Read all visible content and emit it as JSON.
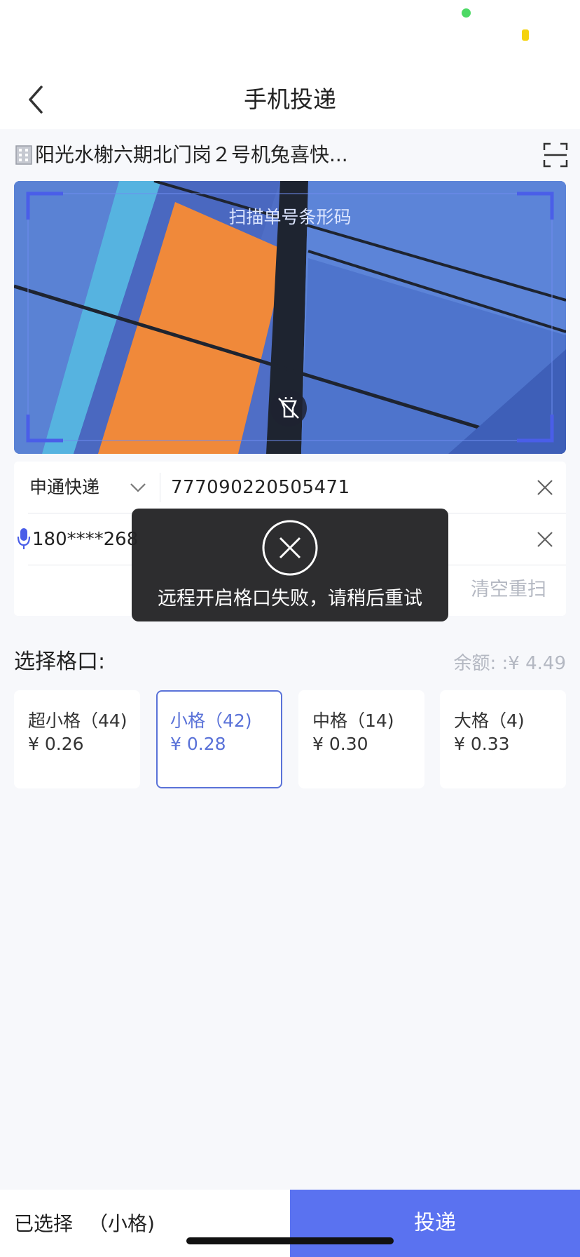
{
  "header": {
    "title": "手机投递"
  },
  "site": {
    "name": "阳光水榭六期北门岗２号机兔喜快..."
  },
  "camera": {
    "hint": "扫描单号条形码"
  },
  "form": {
    "courier": "申通快递",
    "tracking_number": "777090220505471",
    "phone": "180****268",
    "rescan_label": "清空重扫"
  },
  "slots": {
    "title": "选择格口:",
    "balance": "余额: :¥ 4.49",
    "items": [
      {
        "name": "超小格（44)",
        "price": "¥ 0.26",
        "selected": false
      },
      {
        "name": "小格（42)",
        "price": "¥ 0.28",
        "selected": true
      },
      {
        "name": "中格（14)",
        "price": "¥ 0.30",
        "selected": false
      },
      {
        "name": "大格（4)",
        "price": "¥ 0.33",
        "selected": false
      }
    ]
  },
  "toast": {
    "message": "远程开启格口失败，请稍后重试"
  },
  "bottom": {
    "selected_label": "已选择",
    "selected_value": "（小格)",
    "submit_label": "投递"
  },
  "colors": {
    "accent": "#5a72f0",
    "selected_border": "#5a72d8",
    "placeholder_gray": "#b4b8c2"
  }
}
